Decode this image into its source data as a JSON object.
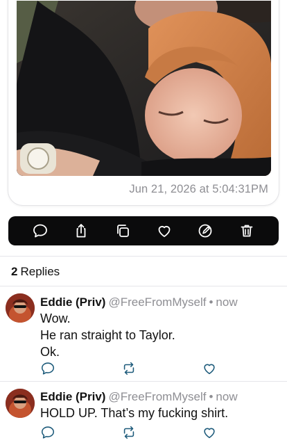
{
  "post": {
    "image_alt": "photo",
    "date": "Jun 21, 2026 at 5:04:31PM"
  },
  "action_bar": {
    "icons": [
      "comment-icon",
      "share-icon",
      "copy-icon",
      "heart-icon",
      "edit-icon",
      "trash-icon"
    ],
    "background": "#0b0b0c",
    "icon_color": "#ffffff"
  },
  "replies": {
    "count": "2",
    "label": "Replies",
    "items": [
      {
        "name": "Eddie (Priv)",
        "handle": "@FreeFromMyself",
        "separator": "•",
        "time": "now",
        "lines": [
          "Wow.",
          "He ran straight to Taylor.",
          "Ok."
        ]
      },
      {
        "name": "Eddie (Priv)",
        "handle": "@FreeFromMyself",
        "separator": "•",
        "time": "now",
        "lines": [
          "HOLD UP. That’s my fucking shirt."
        ]
      }
    ]
  },
  "colors": {
    "accent_icon": "#1c5a7a",
    "muted_text": "#8e8e93",
    "divider": "#e5e5ea"
  }
}
